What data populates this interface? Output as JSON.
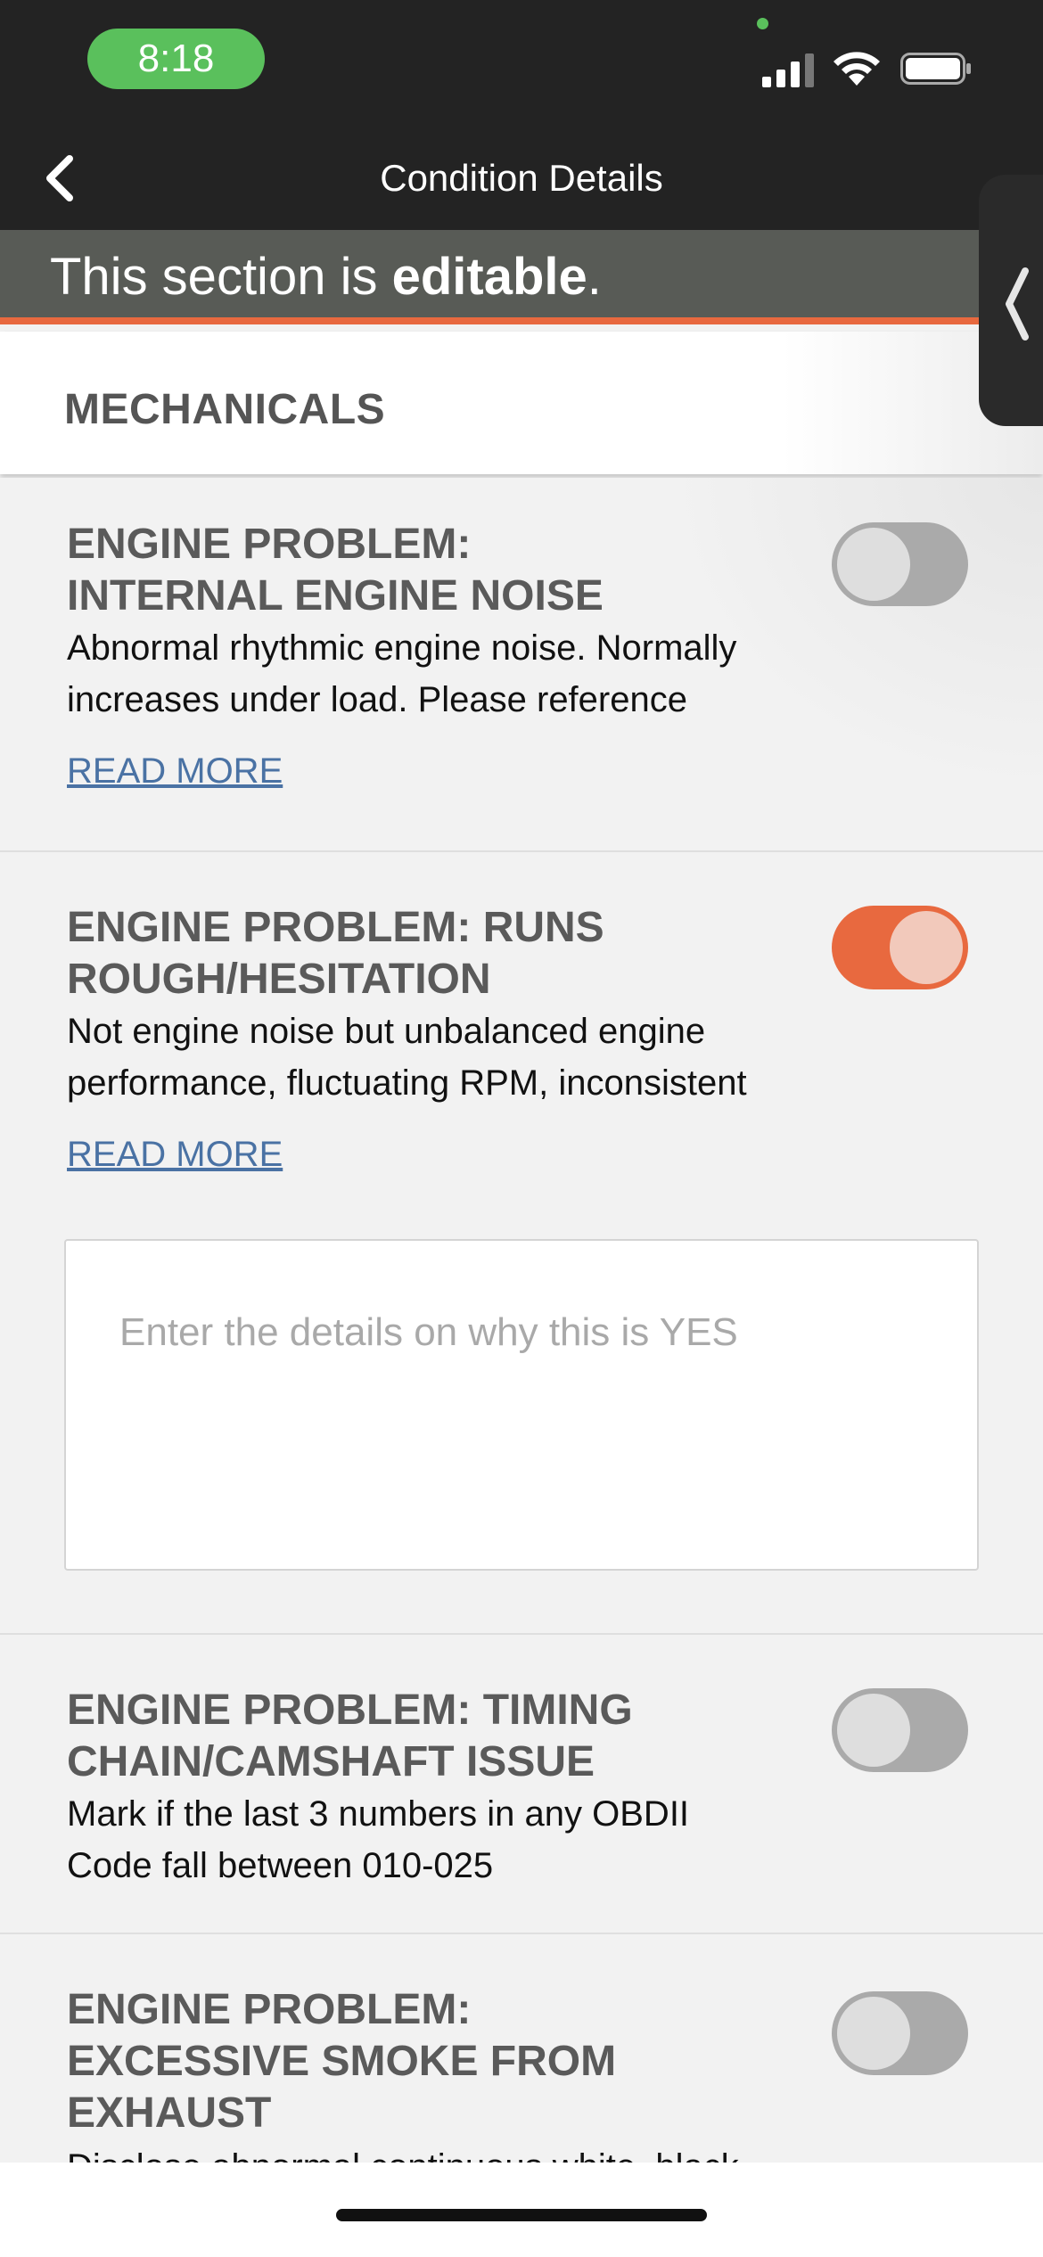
{
  "status_bar": {
    "time": "8:18"
  },
  "nav": {
    "title": "Condition Details"
  },
  "banner": {
    "prefix": "This section is ",
    "emphasis": "editable",
    "suffix": "."
  },
  "section": {
    "title": "MECHANICALS"
  },
  "items": [
    {
      "title_lines": [
        "ENGINE PROBLEM:",
        "INTERNAL ENGINE NOISE"
      ],
      "desc_lines": [
        "Abnormal rhythmic engine noise. Normally",
        "increases under load. Please reference"
      ],
      "read_more": "READ MORE",
      "toggle": "off"
    },
    {
      "title_lines": [
        "ENGINE PROBLEM: RUNS",
        "ROUGH/HESITATION"
      ],
      "desc_lines": [
        "Not engine noise but unbalanced engine",
        "performance, fluctuating RPM, inconsistent"
      ],
      "read_more": "READ MORE",
      "toggle": "on",
      "details_placeholder": "Enter the details on why this is YES"
    },
    {
      "title_lines": [
        "ENGINE PROBLEM: TIMING",
        "CHAIN/CAMSHAFT ISSUE"
      ],
      "desc_lines": [
        "Mark if the last 3 numbers in any OBDII",
        "Code fall between 010-025"
      ],
      "toggle": "off"
    },
    {
      "title_lines": [
        "ENGINE PROBLEM:",
        "EXCESSIVE SMOKE FROM",
        "EXHAUST"
      ],
      "desc_lines": [
        "Disclose abnormal continuous white, black"
      ],
      "toggle": "off"
    }
  ]
}
